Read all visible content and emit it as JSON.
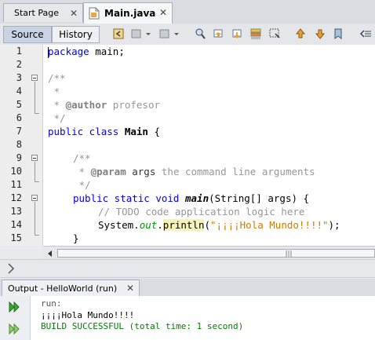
{
  "tabs": [
    {
      "label": "Start Page",
      "close": "✕",
      "active": false
    },
    {
      "label": "Main.java",
      "close": "✕",
      "active": true
    }
  ],
  "toolbar": {
    "source_label": "Source",
    "history_label": "History",
    "icons": [
      "back-icon",
      "forward-history-icon",
      "dropdown-icon",
      "find-icon",
      "find-previous-icon",
      "find-next-icon",
      "toggle-highlight-icon",
      "select-icon",
      "previous-bookmark-icon",
      "next-bookmark-icon",
      "toggle-bookmark-icon",
      "shift-left-icon"
    ]
  },
  "editor": {
    "line_numbers": [
      "1",
      "2",
      "3",
      "4",
      "5",
      "6",
      "7",
      "8",
      "9",
      "10",
      "11",
      "12",
      "13",
      "14",
      "15"
    ],
    "code": {
      "l1_kw": "package",
      "l1_rest": " main;",
      "l3": "/**",
      "l4": " *",
      "l5_star": " * ",
      "l5_tag": "@author",
      "l5_rest": " profesor",
      "l6": " */",
      "l7_kw": "public class ",
      "l7_name": "Main",
      "l7_rest": " {",
      "l9": "/**",
      "l10_star": " * ",
      "l10_tag": "@param",
      "l10_arg": " args",
      "l10_rest": " the command line arguments",
      "l11": " */",
      "l12_kw": "public static void ",
      "l12_name": "main",
      "l12_rest": "(String[] args) {",
      "l13": "// TODO code application logic here",
      "l14_a": "System.",
      "l14_out": "out",
      "l14_dot": ".",
      "l14_m": "println",
      "l14_p": "(",
      "l14_str": "\"¡¡¡¡Hola Mundo!!!!\"",
      "l14_end": ");",
      "l15": "}"
    },
    "colors": {
      "keyword": "#0000e6",
      "comment": "#969696",
      "string": "#ce7b00",
      "field": "#009900"
    }
  },
  "output": {
    "tab_label": "Output - HelloWorld (run)",
    "tab_close": "✕",
    "lines": [
      {
        "text": "run:",
        "color": "#555555"
      },
      {
        "text": "¡¡¡¡Hola Mundo!!!!",
        "color": "#000000"
      },
      {
        "text": "BUILD SUCCESSFUL (total time: 1 second)",
        "color": "#008000"
      }
    ]
  }
}
